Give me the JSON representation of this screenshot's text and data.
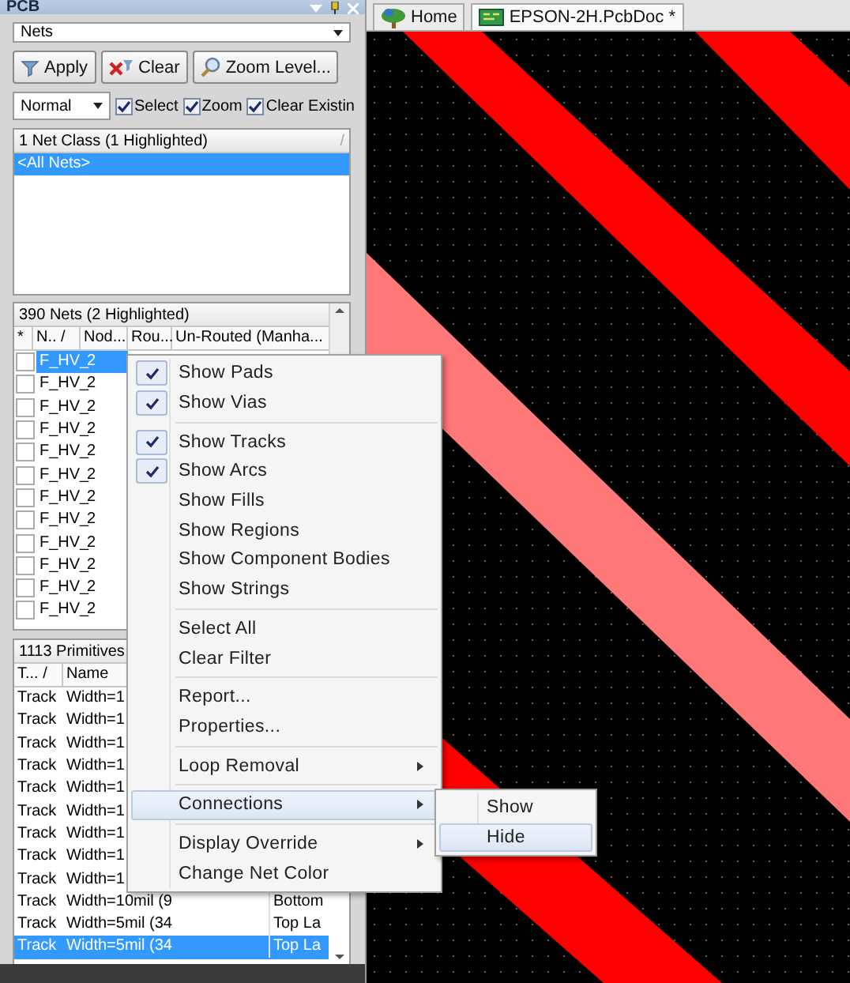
{
  "panel": {
    "title": "PCB",
    "object_dropdown": {
      "value": "Nets"
    },
    "buttons": [
      {
        "label": "Apply"
      },
      {
        "label": "Clear"
      },
      {
        "label": "Zoom Level..."
      }
    ],
    "mask_dropdown": {
      "value": "Normal"
    },
    "options": [
      {
        "label": "Select",
        "checked": true
      },
      {
        "label": "Zoom",
        "checked": true
      },
      {
        "label": "Clear Existin",
        "checked": true
      }
    ],
    "net_classes": {
      "header": "1 Net Class (1 Highlighted)",
      "sort_mark": "/",
      "rows": [
        {
          "name": "<All Nets>",
          "selected": true
        }
      ]
    },
    "nets": {
      "header": "390 Nets (2 Highlighted)",
      "columns": [
        "*",
        "N.. /",
        "Nod...",
        "Rou...",
        "Un-Routed (Manha..."
      ],
      "rows": [
        {
          "name": "F_HV_",
          "nodes": "2",
          "checked": false,
          "selected": true
        },
        {
          "name": "F_HV_",
          "nodes": "2",
          "checked": false,
          "selected": false
        },
        {
          "name": "F_HV_",
          "nodes": "2",
          "checked": false,
          "selected": false
        },
        {
          "name": "F_HV_",
          "nodes": "2",
          "checked": false,
          "selected": false
        },
        {
          "name": "F_HV_",
          "nodes": "2",
          "checked": false,
          "selected": false
        },
        {
          "name": "F_HV_",
          "nodes": "2",
          "checked": false,
          "selected": false
        },
        {
          "name": "F_HV_",
          "nodes": "2",
          "checked": false,
          "selected": false
        },
        {
          "name": "F_HV_",
          "nodes": "2",
          "checked": false,
          "selected": false
        },
        {
          "name": "F_HV_",
          "nodes": "2",
          "checked": false,
          "selected": false
        },
        {
          "name": "F_HV_",
          "nodes": "2",
          "checked": false,
          "selected": false
        },
        {
          "name": "F_HV_",
          "nodes": "2",
          "checked": false,
          "selected": false
        },
        {
          "name": "F_HV_",
          "nodes": "2",
          "checked": false,
          "selected": false
        }
      ]
    },
    "primitives": {
      "header": "1113 Primitives",
      "columns": [
        "T... /",
        "Name"
      ],
      "rows": [
        {
          "type": "Track",
          "name": "Width=1",
          "selected": false
        },
        {
          "type": "Track",
          "name": "Width=1",
          "selected": false
        },
        {
          "type": "Track",
          "name": "Width=1",
          "selected": false
        },
        {
          "type": "Track",
          "name": "Width=1",
          "selected": false
        },
        {
          "type": "Track",
          "name": "Width=1",
          "selected": false
        },
        {
          "type": "Track",
          "name": "Width=1",
          "selected": false
        },
        {
          "type": "Track",
          "name": "Width=1",
          "selected": false
        },
        {
          "type": "Track",
          "name": "Width=1",
          "selected": false
        },
        {
          "type": "Track",
          "name": "Width=1",
          "selected": false
        },
        {
          "type": "Track",
          "name": "Width=10mil (9",
          "layer": "Bottom",
          "selected": false
        },
        {
          "type": "Track",
          "name": "Width=5mil (34",
          "layer": "Top La",
          "selected": false
        },
        {
          "type": "Track",
          "name": "Width=5mil (34",
          "layer": "Top La",
          "selected": true
        }
      ]
    }
  },
  "document_tabs": [
    {
      "label": "Home",
      "selected": false
    },
    {
      "label": "EPSON-2H.PcbDoc *",
      "selected": true
    }
  ],
  "context_menu": {
    "items": [
      {
        "kind": "item",
        "label": "Show Pads",
        "checked": true,
        "highlighted": false
      },
      {
        "kind": "item",
        "label": "Show Vias",
        "checked": true,
        "highlighted": false
      },
      {
        "kind": "separator"
      },
      {
        "kind": "item",
        "label": "Show Tracks",
        "checked": true,
        "highlighted": false
      },
      {
        "kind": "item",
        "label": "Show Arcs",
        "checked": true,
        "highlighted": false
      },
      {
        "kind": "item",
        "label": "Show Fills",
        "checked": false,
        "highlighted": false
      },
      {
        "kind": "item",
        "label": "Show Regions",
        "checked": false,
        "highlighted": false
      },
      {
        "kind": "item",
        "label": "Show Component Bodies",
        "checked": false,
        "highlighted": false
      },
      {
        "kind": "item",
        "label": "Show Strings",
        "checked": false,
        "highlighted": false
      },
      {
        "kind": "separator"
      },
      {
        "kind": "item",
        "label": "Select All",
        "checked": false,
        "highlighted": false
      },
      {
        "kind": "item",
        "label": "Clear Filter",
        "checked": false,
        "highlighted": false
      },
      {
        "kind": "separator"
      },
      {
        "kind": "item",
        "label": "Report...",
        "checked": false,
        "highlighted": false
      },
      {
        "kind": "item",
        "label": "Properties...",
        "checked": false,
        "highlighted": false
      },
      {
        "kind": "separator"
      },
      {
        "kind": "submenu",
        "label": "Loop Removal",
        "checked": false,
        "highlighted": false
      },
      {
        "kind": "separator"
      },
      {
        "kind": "submenu",
        "label": "Connections",
        "checked": false,
        "highlighted": true
      },
      {
        "kind": "separator"
      },
      {
        "kind": "submenu",
        "label": "Display Override",
        "checked": false,
        "highlighted": false
      },
      {
        "kind": "item",
        "label": "Change Net Color",
        "checked": false,
        "highlighted": false
      }
    ]
  },
  "submenu": {
    "items": [
      {
        "label": "Show",
        "highlighted": false
      },
      {
        "label": "Hide",
        "highlighted": true
      }
    ]
  }
}
